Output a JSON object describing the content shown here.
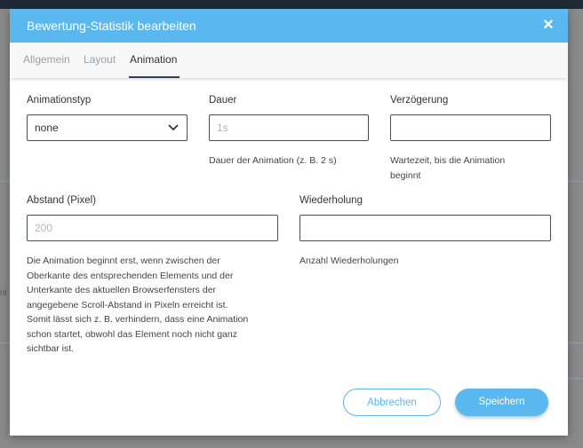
{
  "modal": {
    "title": "Bewertung-Statistik bearbeiten",
    "close_icon": "close-icon"
  },
  "tabs": [
    {
      "label": "Allgemein",
      "active": false
    },
    {
      "label": "Layout",
      "active": false
    },
    {
      "label": "Animation",
      "active": true
    }
  ],
  "fields": {
    "animationstyp": {
      "label": "Animationstyp",
      "value": "none"
    },
    "dauer": {
      "label": "Dauer",
      "placeholder": "1s",
      "help": "Dauer der Animation (z. B. 2 s)"
    },
    "verzoegerung": {
      "label": "Verzögerung",
      "placeholder": "",
      "help_line1": "Wartezeit, bis die Animation",
      "help_line2": "beginnt"
    },
    "abstand": {
      "label": "Abstand (Pixel)",
      "placeholder": "200",
      "help_lines": [
        "Die Animation beginnt erst, wenn zwischen der",
        "Oberkante des entsprechenden Elements und der",
        "Unterkante des aktuellen Browserfensters der",
        "angegebene Scroll-Abstand in Pixeln erreicht ist.",
        "Somit lässt sich z. B. verhindern, dass eine Animation",
        "schon startet, obwohl das Element noch nicht ganz",
        "sichtbar ist."
      ]
    },
    "wiederholung": {
      "label": "Wiederholung",
      "placeholder": "",
      "help": "Anzahl Wiederholungen"
    }
  },
  "buttons": {
    "cancel": "Abbrechen",
    "save": "Speichern"
  },
  "background": {
    "stub_text": "ni"
  },
  "colors": {
    "accent": "#5bb8ef",
    "header_text": "#ffffff",
    "overlay": "#8a8a8a"
  }
}
